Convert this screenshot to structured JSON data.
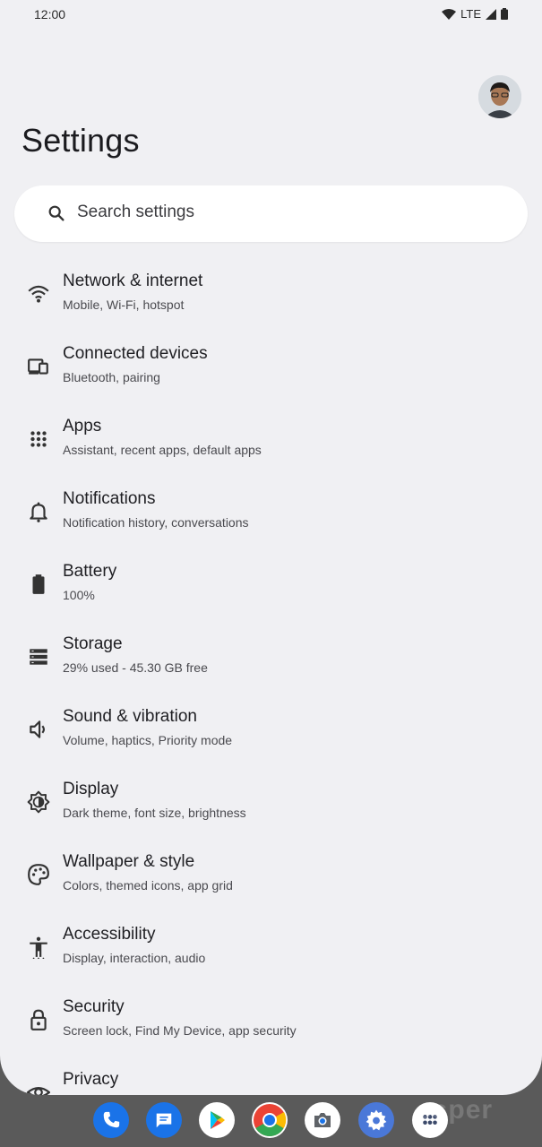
{
  "status_bar": {
    "time": "12:00",
    "network": "LTE"
  },
  "header": {
    "title": "Settings"
  },
  "search": {
    "placeholder": "Search settings"
  },
  "items": [
    {
      "label": "Network & internet",
      "sub": "Mobile, Wi-Fi, hotspot",
      "icon": "wifi-icon"
    },
    {
      "label": "Connected devices",
      "sub": "Bluetooth, pairing",
      "icon": "devices-icon"
    },
    {
      "label": "Apps",
      "sub": "Assistant, recent apps, default apps",
      "icon": "apps-grid-icon"
    },
    {
      "label": "Notifications",
      "sub": "Notification history, conversations",
      "icon": "bell-icon"
    },
    {
      "label": "Battery",
      "sub": "100%",
      "icon": "battery-icon"
    },
    {
      "label": "Storage",
      "sub": "29% used - 45.30 GB free",
      "icon": "storage-icon"
    },
    {
      "label": "Sound & vibration",
      "sub": "Volume, haptics, Priority mode",
      "icon": "speaker-icon"
    },
    {
      "label": "Display",
      "sub": "Dark theme, font size, brightness",
      "icon": "brightness-icon"
    },
    {
      "label": "Wallpaper & style",
      "sub": "Colors, themed icons, app grid",
      "icon": "palette-icon"
    },
    {
      "label": "Accessibility",
      "sub": "Display, interaction, audio",
      "icon": "accessibility-icon"
    },
    {
      "label": "Security",
      "sub": "Screen lock, Find My Device, app security",
      "icon": "lock-icon"
    },
    {
      "label": "Privacy",
      "sub": "",
      "icon": "eye-icon"
    }
  ],
  "dock": [
    {
      "name": "phone-app-icon",
      "color": "#1a73e8"
    },
    {
      "name": "messages-app-icon",
      "color": "#1a73e8"
    },
    {
      "name": "play-store-app-icon",
      "color": "#ffffff"
    },
    {
      "name": "chrome-app-icon",
      "color": "#ffffff"
    },
    {
      "name": "camera-app-icon",
      "color": "#ffffff"
    },
    {
      "name": "settings-app-icon",
      "color": "#4a78d8"
    },
    {
      "name": "app-drawer-icon",
      "color": "#ffffff"
    }
  ],
  "watermark": "esper"
}
